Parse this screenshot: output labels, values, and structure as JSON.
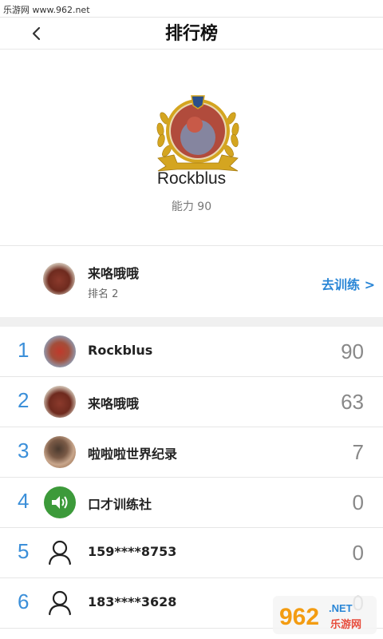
{
  "watermark": {
    "text": "乐游网 www.962.net"
  },
  "nav": {
    "title": "排行榜"
  },
  "hero": {
    "name": "Rockblus",
    "score_label": "能力 90"
  },
  "me": {
    "name": "来咯哦哦",
    "rank_label": "排名 2",
    "train_label": "去训练 >"
  },
  "ranking": [
    {
      "rank": "1",
      "name": "Rockblus",
      "score": "90",
      "avatar": "photo"
    },
    {
      "rank": "2",
      "name": "来咯哦哦",
      "score": "63",
      "avatar": "photo"
    },
    {
      "rank": "3",
      "name": "啦啦啦世界纪录",
      "score": "7",
      "avatar": "photo"
    },
    {
      "rank": "4",
      "name": "口才训练社",
      "score": "0",
      "avatar": "speaker-icon"
    },
    {
      "rank": "5",
      "name": "159****8753",
      "score": "0",
      "avatar": "user-icon"
    },
    {
      "rank": "6",
      "name": "183****3628",
      "score": "0",
      "avatar": "user-icon"
    }
  ],
  "logo": {
    "text": "962",
    "subtext": "乐游网",
    "net": ".NET"
  },
  "colors": {
    "accent": "#2a86d6",
    "rank_number": "#3b8fd9",
    "gold": "#d4a520"
  }
}
